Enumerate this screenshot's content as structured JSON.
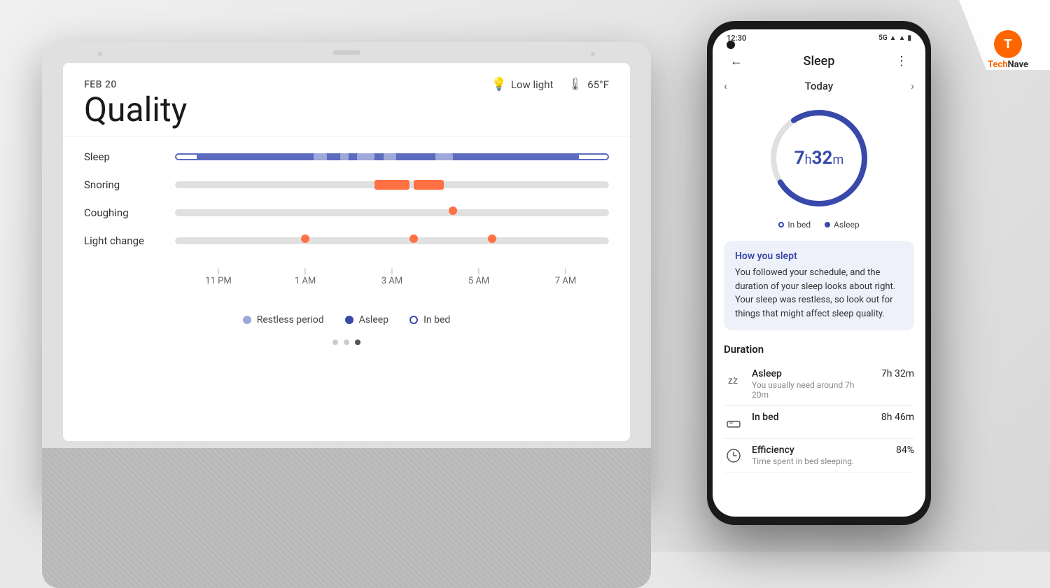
{
  "background": {
    "color": "#e0e0e0"
  },
  "technave": {
    "name": "TechNave",
    "tech": "Tech",
    "nave": "Nave"
  },
  "tablet": {
    "date": "FEB 20",
    "title": "Quality",
    "condition_light": "Low light",
    "condition_temp": "65°F",
    "metrics": [
      {
        "label": "Sleep"
      },
      {
        "label": "Snoring"
      },
      {
        "label": "Coughing"
      },
      {
        "label": "Light change"
      }
    ],
    "time_labels": [
      "11 PM",
      "1 AM",
      "3 AM",
      "5 AM",
      "7 AM"
    ],
    "legend_items": [
      {
        "label": "Restless period",
        "type": "light"
      },
      {
        "label": "Asleep",
        "type": "dark"
      },
      {
        "label": "In bed",
        "type": "empty"
      }
    ]
  },
  "phone": {
    "status_time": "12:30",
    "status_signal": "5G",
    "title": "Sleep",
    "date_label": "Today",
    "sleep_hours": "7",
    "sleep_minutes": "32",
    "sleep_hours_label": "h",
    "sleep_minutes_label": "m",
    "legend_in_bed": "In bed",
    "legend_asleep": "Asleep",
    "how_slept_title": "How you slept",
    "how_slept_text": "You followed your schedule, and the duration of your sleep looks about right. Your sleep was restless, so look out for things that might affect sleep quality.",
    "duration_title": "Duration",
    "duration_items": [
      {
        "icon": "sleep-icon",
        "name": "Asleep",
        "sub": "You usually need around 7h 20m",
        "value": "7h 32m"
      },
      {
        "icon": "bed-icon",
        "name": "In bed",
        "sub": "",
        "value": "8h 46m"
      },
      {
        "icon": "efficiency-icon",
        "name": "Efficiency",
        "sub": "Time spent in bed sleeping.",
        "value": "84%"
      }
    ]
  }
}
